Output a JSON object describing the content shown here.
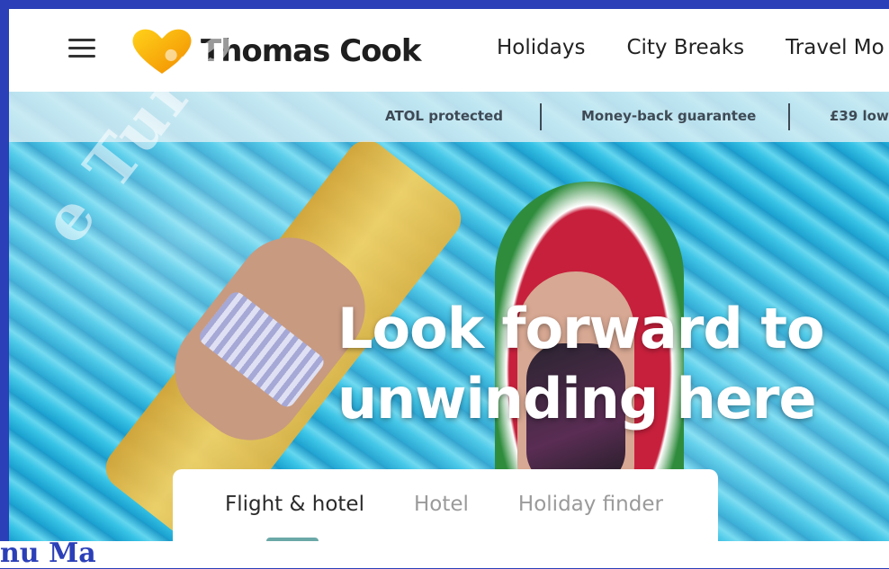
{
  "brand": {
    "name": "Thomas Cook",
    "logo": "heart-logo-icon",
    "colors": {
      "logo_yellow": "#f7b500",
      "logo_orange": "#f28c00"
    }
  },
  "nav": {
    "items": [
      {
        "label": "Holidays"
      },
      {
        "label": "City Breaks"
      },
      {
        "label": "Travel Mo"
      }
    ]
  },
  "trust_bar": {
    "items": [
      "ATOL protected",
      "Money-back guarantee",
      "£39 low"
    ]
  },
  "hero": {
    "headline": [
      "Look forward to",
      "unwinding here"
    ]
  },
  "search": {
    "tabs": [
      {
        "label": "Flight & hotel",
        "active": true
      },
      {
        "label": "Hotel"
      },
      {
        "label": "Holiday finder"
      }
    ]
  },
  "watermark": {
    "diagonal_text": "e Turismo, ",
    "bottom_text": "nu Ma"
  }
}
